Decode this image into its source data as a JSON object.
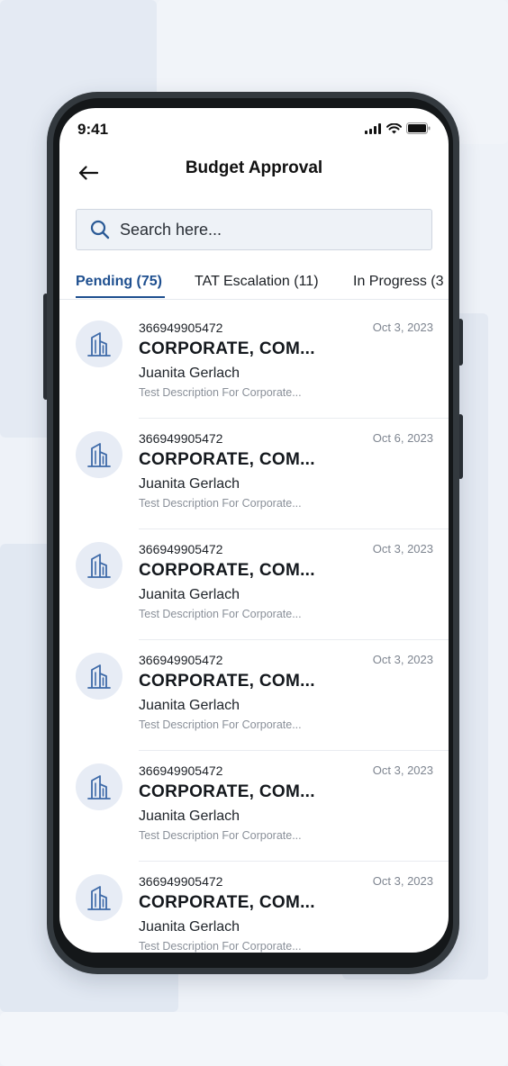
{
  "status_bar": {
    "time": "9:41"
  },
  "header": {
    "title": "Budget Approval",
    "back_icon": "arrow-left-icon"
  },
  "search": {
    "placeholder": "Search here...",
    "value": ""
  },
  "tabs": [
    {
      "label": "Pending (75)",
      "active": true
    },
    {
      "label": "TAT Escalation (11)",
      "active": false
    },
    {
      "label": "In Progress (3",
      "active": false
    }
  ],
  "items": [
    {
      "ref": "366949905472",
      "date": "Oct 3, 2023",
      "company": "CORPORATE, COM...",
      "person": "Juanita Gerlach",
      "desc": "Test Description For Corporate...",
      "icon": "building-icon"
    },
    {
      "ref": "366949905472",
      "date": "Oct 6, 2023",
      "company": "CORPORATE, COM...",
      "person": "Juanita Gerlach",
      "desc": "Test Description For Corporate...",
      "icon": "building-icon"
    },
    {
      "ref": "366949905472",
      "date": "Oct 3, 2023",
      "company": "CORPORATE, COM...",
      "person": "Juanita Gerlach",
      "desc": "Test Description For Corporate...",
      "icon": "building-icon"
    },
    {
      "ref": "366949905472",
      "date": "Oct 3, 2023",
      "company": "CORPORATE, COM...",
      "person": "Juanita Gerlach",
      "desc": "Test Description For Corporate...",
      "icon": "building-icon"
    },
    {
      "ref": "366949905472",
      "date": "Oct 3, 2023",
      "company": "CORPORATE, COM...",
      "person": "Juanita Gerlach",
      "desc": "Test Description For Corporate...",
      "icon": "building-icon"
    },
    {
      "ref": "366949905472",
      "date": "Oct 3, 2023",
      "company": "CORPORATE, COM...",
      "person": "Juanita Gerlach",
      "desc": "Test Description For Corporate...",
      "icon": "building-icon"
    }
  ],
  "colors": {
    "accent": "#1e4f8f",
    "background": "#eef2f8",
    "avatar_bg": "#e7ecf5"
  }
}
